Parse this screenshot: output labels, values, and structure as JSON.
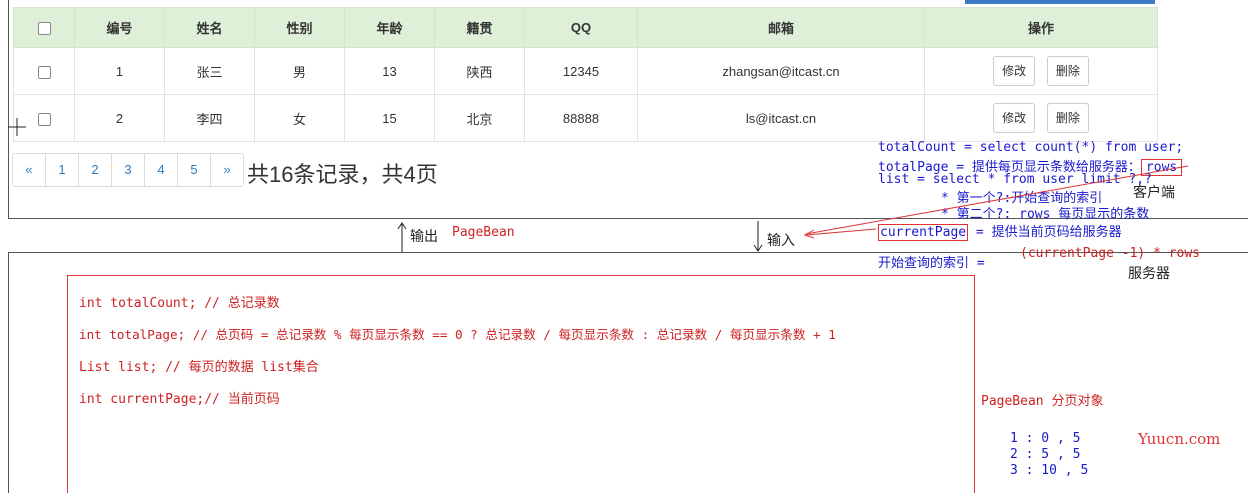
{
  "table": {
    "headers": [
      "编号",
      "姓名",
      "性别",
      "年龄",
      "籍贯",
      "QQ",
      "邮箱",
      "操作"
    ],
    "rows": [
      {
        "id": "1",
        "name": "张三",
        "gender": "男",
        "age": "13",
        "hometown": "陕西",
        "qq": "12345",
        "email": "zhangsan@itcast.cn"
      },
      {
        "id": "2",
        "name": "李四",
        "gender": "女",
        "age": "15",
        "hometown": "北京",
        "qq": "88888",
        "email": "ls@itcast.cn"
      }
    ],
    "edit_label": "修改",
    "delete_label": "删除"
  },
  "pager": {
    "items": [
      "«",
      "1",
      "2",
      "3",
      "4",
      "5",
      "»"
    ],
    "summary": "共16条记录，共4页"
  },
  "annotations": {
    "client": {
      "line1": "totalCount = select count(*) from user;",
      "line2_prefix": "totalPage = 提供每页显示条数给服务器：",
      "rows_box": "rows",
      "line3": "list = select * from user limit ?,?",
      "line4": "* 第一个?:开始查询的索引",
      "line5": "* 第二个?: rows 每页显示的条数",
      "client_label": "客户端",
      "current_page_box": "currentPage",
      "current_page_desc": "= 提供当前页码给服务器",
      "start_index": "开始查询的索引 =",
      "formula": "(currentPage -1) * rows",
      "server_label": "服务器"
    },
    "output_label": "输出",
    "pagebean": "PageBean",
    "input_label": "输入"
  },
  "code": {
    "lines": [
      "int totalCount; // 总记录数",
      "int totalPage; // 总页码 = 总记录数 % 每页显示条数 == 0 ? 总记录数 / 每页显示条数 : 总记录数 / 每页显示条数 + 1",
      "List list;  // 每页的数据 list集合",
      "int currentPage;// 当前页码"
    ],
    "pagebean_label": "PageBean 分页对象",
    "examples": [
      "1 :  0 , 5",
      "2 :  5 , 5",
      "3 : 10 , 5"
    ]
  },
  "watermark": "Yuucn.com"
}
